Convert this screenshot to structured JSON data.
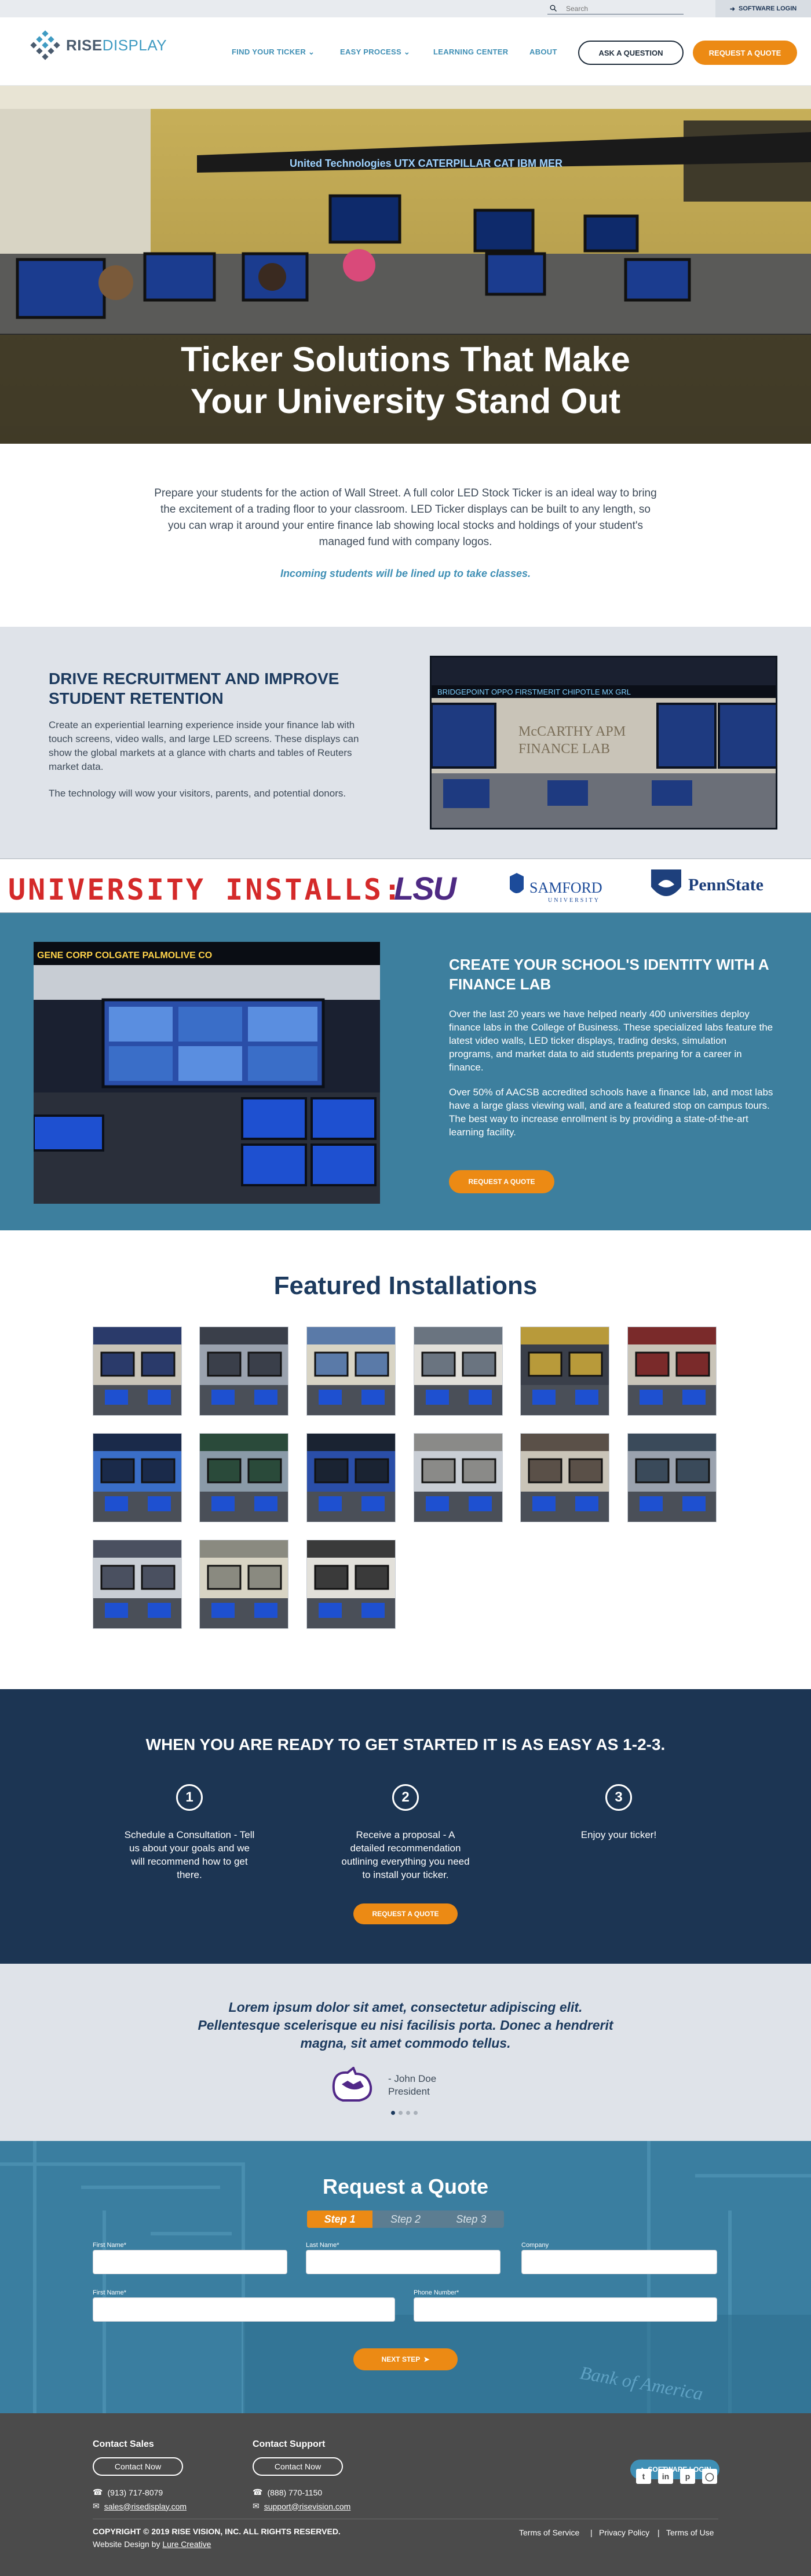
{
  "utility": {
    "search_placeholder": "Search",
    "login_label": "SOFTWARE LOGIN"
  },
  "nav": {
    "logo_part1": "RISE",
    "logo_part2": "DISPLAY",
    "links": [
      "FIND YOUR TICKER",
      "EASY PROCESS",
      "LEARNING CENTER",
      "ABOUT"
    ],
    "ask_label": "ASK A QUESTION",
    "quote_label": "REQUEST A QUOTE"
  },
  "hero": {
    "title_line1": "Ticker Solutions That Make",
    "title_line2": "Your University Stand Out",
    "ticker_text": "United Technologies   UTX   CATERPILLAR   CAT   IBM   MER"
  },
  "intro": {
    "body": "Prepare your students for the action of Wall Street. A full color LED Stock Ticker is an ideal way to bring the excitement of a trading floor to your classroom. LED Ticker displays can be built to any length, so you can wrap it around your entire finance lab showing local stocks and holdings of your student's managed fund with company logos.",
    "highlight": "Incoming students will be lined up to take classes."
  },
  "drive": {
    "title": "DRIVE RECRUITMENT AND IMPROVE STUDENT RETENTION",
    "p1": "Create an experiential learning experience inside your finance lab with touch screens, video walls, and large LED screens. These displays can show the global markets at a glance with charts and tables of Reuters market data.",
    "p2": "The technology will wow your visitors, parents, and potential donors.",
    "photo_sign_line1": "McCARTHY APM",
    "photo_sign_line2": "FINANCE LAB"
  },
  "installs": {
    "label": "UNIVERSITY INSTALLS:",
    "logos": {
      "lsu": "LSU",
      "samford": "SAMFORD",
      "samford_sub": "UNIVERSITY",
      "pennstate": "PennState"
    }
  },
  "identity": {
    "title": "CREATE YOUR SCHOOL'S IDENTITY WITH A FINANCE LAB",
    "p1": "Over the last 20 years we have helped nearly 400 universities deploy finance labs in the College of Business. These specialized labs feature the latest video walls, LED ticker displays, trading desks, simulation programs, and market data to aid students preparing for a career in finance.",
    "p2": "Over 50% of AACSB accredited schools have a finance lab, and most labs have a large glass viewing wall, and are a featured stop on campus tours. The best way to increase enrollment is by providing a state-of-the-art learning facility.",
    "button": "REQUEST A QUOTE",
    "ticker_text": "GENE CORP   COLGATE PALMOLIVE CO"
  },
  "featured": {
    "title": "Featured Installations"
  },
  "steps": {
    "title": "WHEN YOU ARE READY TO GET STARTED IT IS AS EASY AS 1-2-3.",
    "items": [
      {
        "num": "1",
        "text": "Schedule a Consultation - Tell us about your goals and we will recommend how to get there."
      },
      {
        "num": "2",
        "text": "Receive a proposal - A detailed recommendation outlining everything you need to install your ticker."
      },
      {
        "num": "3",
        "text": "Enjoy your ticker!"
      }
    ],
    "button": "REQUEST A QUOTE"
  },
  "testimonial": {
    "quote": "Lorem ipsum dolor sit amet, consectetur adipiscing elit. Pellentesque scelerisque eu nisi facilisis porta. Donec a hendrerit magna, sit amet commodo tellus.",
    "name": "- John Doe",
    "role": "President"
  },
  "quote_form": {
    "title": "Request a Quote",
    "steps": [
      "Step 1",
      "Step 2",
      "Step 3"
    ],
    "fields": {
      "first_name": "First Name",
      "last_name": "Last Name",
      "company": "Company",
      "first_name_2": "First Name",
      "phone": "Phone Number"
    },
    "next_label": "NEXT STEP",
    "bg_sign": "Bank of America"
  },
  "footer": {
    "sales_title": "Contact Sales",
    "support_title": "Contact Support",
    "contact_button": "Contact Now",
    "sales_phone": "(913) 717-8079",
    "sales_email": "sales@risedisplay.com",
    "support_phone": "(888) 770-1150",
    "support_email": "support@risevision.com",
    "login_label": "SOFTWARE LOGIN",
    "social": [
      "twitter",
      "linkedin",
      "pinterest",
      "instagram"
    ],
    "copyright": "COPYRIGHT © 2019 RISE VISION, INC. ALL RIGHTS RESERVED.",
    "design_prefix": "Website Design by ",
    "design_link": "Lure Creative",
    "legal": [
      "Terms of Service",
      "Privacy Policy",
      "Terms of Use"
    ],
    "separator": "|"
  },
  "colors": {
    "navy": "#1c3a5e",
    "orange": "#ec8a14",
    "teal": "#3d7f9e",
    "link_blue": "#3f8fb5",
    "footer_gray": "#4b4b4b"
  }
}
